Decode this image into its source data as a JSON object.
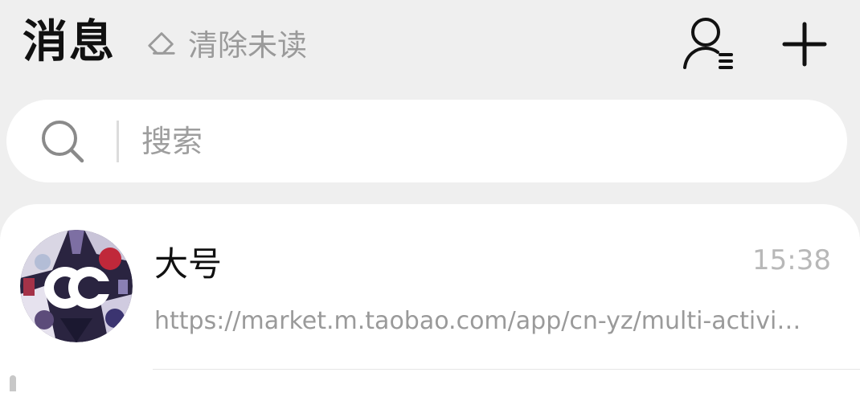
{
  "header": {
    "title": "消息",
    "clear_unread_label": "清除未读"
  },
  "search": {
    "placeholder": "搜索"
  },
  "conversations": [
    {
      "name": "大号",
      "time": "15:38",
      "preview": "https://market.m.taobao.com/app/cn-yz/multi-activi…"
    }
  ],
  "colors": {
    "background": "#efefef",
    "surface": "#ffffff",
    "title_text": "#111111",
    "secondary_text": "#9a9a9a",
    "time_text": "#b8b8b8"
  },
  "icons": {
    "clear": "eraser-icon",
    "contacts": "contacts-list-icon",
    "add": "plus-icon",
    "search": "search-icon"
  }
}
